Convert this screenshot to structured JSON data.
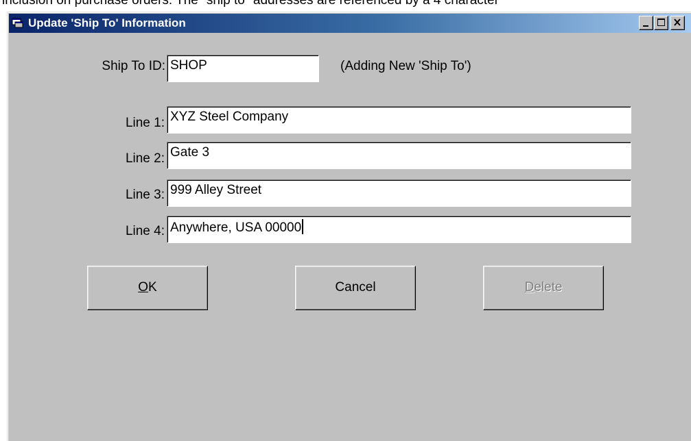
{
  "document": {
    "background_text": "inclusion on purchase orders.  The \"ship to\" addresses are referenced by a 4 character"
  },
  "window": {
    "title": "Update 'Ship To' Information",
    "title_icon": "app-window-icon",
    "controls": [
      "minimize-icon",
      "maximize-icon",
      "close-icon"
    ]
  },
  "form": {
    "ship_to_id": {
      "label": "Ship To ID:",
      "value": "SHOP"
    },
    "status_text": "(Adding New 'Ship To')",
    "lines": [
      {
        "label": "Line 1:",
        "value": "XYZ Steel Company"
      },
      {
        "label": "Line 2:",
        "value": "Gate 3"
      },
      {
        "label": "Line 3:",
        "value": "999 Alley Street"
      },
      {
        "label": "Line 4:",
        "value": "Anywhere, USA 00000"
      }
    ]
  },
  "buttons": {
    "ok": {
      "mnemonic": "O",
      "rest": "K"
    },
    "cancel": {
      "label": "Cancel"
    },
    "delete": {
      "mnemonic": "D",
      "rest": "elete",
      "disabled": true
    }
  },
  "colors": {
    "dialog_face": "#c0c0c0",
    "title_active": "#0a246a",
    "title_gradient_end": "#a6caf0"
  }
}
